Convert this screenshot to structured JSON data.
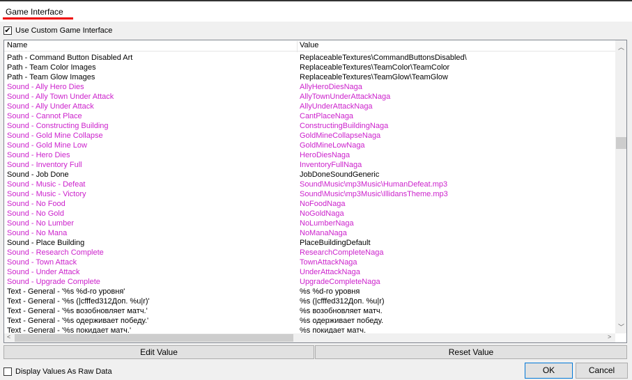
{
  "tab": {
    "title": "Game Interface"
  },
  "use_custom": {
    "label": "Use Custom Game Interface",
    "checked": true
  },
  "columns": {
    "name": "Name",
    "value": "Value"
  },
  "colors": {
    "modified": "#cc22cc",
    "default": "#000000",
    "tab_underline": "#e00000"
  },
  "rows": [
    {
      "name": "Path - Command Button Disabled Art",
      "value": "ReplaceableTextures\\CommandButtonsDisabled\\",
      "modified": false
    },
    {
      "name": "Path - Team Color Images",
      "value": "ReplaceableTextures\\TeamColor\\TeamColor",
      "modified": false
    },
    {
      "name": "Path - Team Glow Images",
      "value": "ReplaceableTextures\\TeamGlow\\TeamGlow",
      "modified": false
    },
    {
      "name": "Sound - Ally Hero Dies",
      "value": "AllyHeroDiesNaga",
      "modified": true
    },
    {
      "name": "Sound - Ally Town Under Attack",
      "value": "AllyTownUnderAttackNaga",
      "modified": true
    },
    {
      "name": "Sound - Ally Under Attack",
      "value": "AllyUnderAttackNaga",
      "modified": true
    },
    {
      "name": "Sound - Cannot Place",
      "value": "CantPlaceNaga",
      "modified": true
    },
    {
      "name": "Sound - Constructing Building",
      "value": "ConstructingBuildingNaga",
      "modified": true
    },
    {
      "name": "Sound - Gold Mine Collapse",
      "value": "GoldMineCollapseNaga",
      "modified": true
    },
    {
      "name": "Sound - Gold Mine Low",
      "value": "GoldMineLowNaga",
      "modified": true
    },
    {
      "name": "Sound - Hero Dies",
      "value": "HeroDiesNaga",
      "modified": true
    },
    {
      "name": "Sound - Inventory Full",
      "value": "InventoryFullNaga",
      "modified": true
    },
    {
      "name": "Sound - Job Done",
      "value": "JobDoneSoundGeneric",
      "modified": false
    },
    {
      "name": "Sound - Music - Defeat",
      "value": "Sound\\Music\\mp3Music\\HumanDefeat.mp3",
      "modified": true
    },
    {
      "name": "Sound - Music - Victory",
      "value": "Sound\\Music\\mp3Music\\IllidansTheme.mp3",
      "modified": true
    },
    {
      "name": "Sound - No Food",
      "value": "NoFoodNaga",
      "modified": true
    },
    {
      "name": "Sound - No Gold",
      "value": "NoGoldNaga",
      "modified": true
    },
    {
      "name": "Sound - No Lumber",
      "value": "NoLumberNaga",
      "modified": true
    },
    {
      "name": "Sound - No Mana",
      "value": "NoManaNaga",
      "modified": true
    },
    {
      "name": "Sound - Place Building",
      "value": "PlaceBuildingDefault",
      "modified": false
    },
    {
      "name": "Sound - Research Complete",
      "value": "ResearchCompleteNaga",
      "modified": true
    },
    {
      "name": "Sound - Town Attack",
      "value": "TownAttackNaga",
      "modified": true
    },
    {
      "name": "Sound - Under Attack",
      "value": "UnderAttackNaga",
      "modified": true
    },
    {
      "name": "Sound - Upgrade Complete",
      "value": "UpgradeCompleteNaga",
      "modified": true
    },
    {
      "name": "Text - General - '%s %d-го уровня'",
      "value": "%s %d-го уровня",
      "modified": false
    },
    {
      "name": "Text - General - '%s (|cfffed312Доп. %u|r)'",
      "value": "%s (|cfffed312Доп. %u|r)",
      "modified": false
    },
    {
      "name": "Text - General - '%s возобновляет матч.'",
      "value": "%s возобновляет матч.",
      "modified": false
    },
    {
      "name": "Text - General - '%s одерживает победу.'",
      "value": "%s одерживает победу.",
      "modified": false
    },
    {
      "name": "Text - General - '%s покидает матч.'",
      "value": "%s покидает матч.",
      "modified": false
    }
  ],
  "buttons": {
    "edit": "Edit Value",
    "reset": "Reset Value",
    "ok": "OK",
    "cancel": "Cancel"
  },
  "raw_data": {
    "label": "Display Values As Raw Data",
    "checked": false
  }
}
